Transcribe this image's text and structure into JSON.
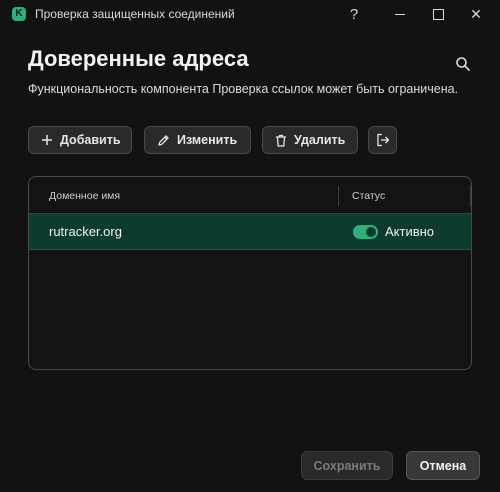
{
  "window": {
    "title": "Проверка защищенных соединений",
    "app_icon_letter": "K",
    "help_label": "?",
    "close_label": "✕"
  },
  "header": {
    "title": "Доверенные адреса",
    "subtitle": "Функциональность компонента Проверка ссылок может быть ограничена."
  },
  "toolbar": {
    "add_label": "Добавить",
    "edit_label": "Изменить",
    "delete_label": "Удалить"
  },
  "table": {
    "columns": [
      "Доменное имя",
      "Статус"
    ],
    "rows": [
      {
        "domain": "rutracker.org",
        "status": "Активно",
        "enabled": true
      }
    ]
  },
  "footer": {
    "save_label": "Сохранить",
    "cancel_label": "Отмена"
  },
  "colors": {
    "accent": "#2fae7a",
    "selected_row": "#0e3b30",
    "background": "#121213"
  },
  "icons": {
    "search": "search-icon",
    "add": "plus-icon",
    "edit": "pencil-icon",
    "delete": "trash-icon",
    "export": "export-icon"
  }
}
